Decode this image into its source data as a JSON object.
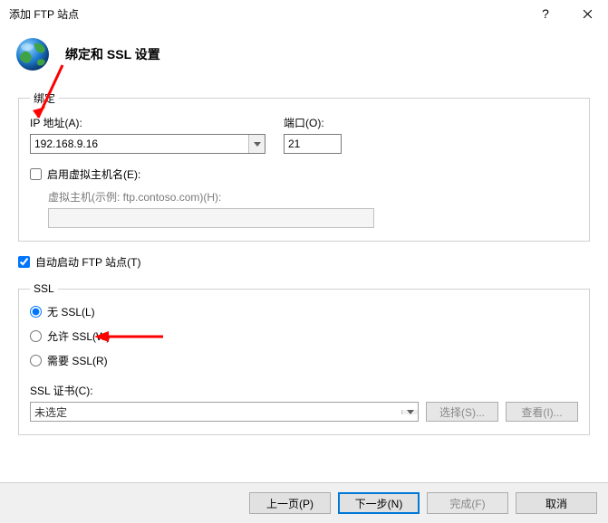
{
  "title": "添加 FTP 站点",
  "header_title": "绑定和 SSL 设置",
  "binding": {
    "legend": "绑定",
    "ip_label": "IP 地址(A):",
    "ip_value": "192.168.9.16",
    "port_label": "端口(O):",
    "port_value": "21",
    "vhost_label": "启用虚拟主机名(E):",
    "vhost_checked": false,
    "vhost_sub_label": "虚拟主机(示例: ftp.contoso.com)(H):"
  },
  "auto_start": {
    "label": "自动启动 FTP 站点(T)",
    "checked": true
  },
  "ssl": {
    "legend": "SSL",
    "options": {
      "none": "无 SSL(L)",
      "allow": "允许 SSL(W)",
      "require": "需要 SSL(R)"
    },
    "selected": "none",
    "cert_label": "SSL 证书(C):",
    "cert_value": "未选定",
    "select_btn": "选择(S)...",
    "view_btn": "查看(I)..."
  },
  "footer": {
    "prev": "上一页(P)",
    "next": "下一步(N)",
    "finish": "完成(F)",
    "cancel": "取消"
  }
}
